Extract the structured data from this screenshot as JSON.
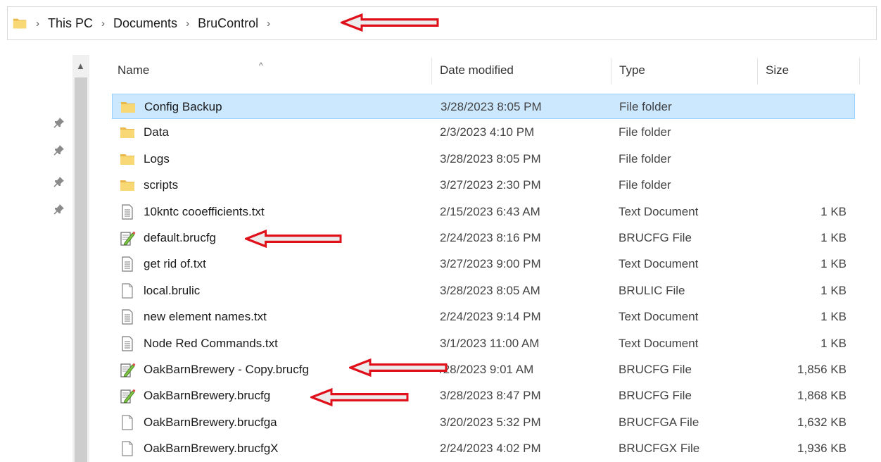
{
  "breadcrumb": [
    "This PC",
    "Documents",
    "BruControl"
  ],
  "columns": {
    "name": "Name",
    "date": "Date modified",
    "type": "Type",
    "size": "Size"
  },
  "files": [
    {
      "name": "Config Backup",
      "date": "3/28/2023 8:05 PM",
      "type": "File folder",
      "size": "",
      "icon": "folder-icon",
      "selected": true
    },
    {
      "name": "Data",
      "date": "2/3/2023 4:10 PM",
      "type": "File folder",
      "size": "",
      "icon": "folder-icon"
    },
    {
      "name": "Logs",
      "date": "3/28/2023 8:05 PM",
      "type": "File folder",
      "size": "",
      "icon": "folder-icon"
    },
    {
      "name": "scripts",
      "date": "3/27/2023 2:30 PM",
      "type": "File folder",
      "size": "",
      "icon": "folder-icon"
    },
    {
      "name": "10kntc cooefficients.txt",
      "date": "2/15/2023 6:43 AM",
      "type": "Text Document",
      "size": "1 KB",
      "icon": "text-document-icon"
    },
    {
      "name": "default.brucfg",
      "date": "2/24/2023 8:16 PM",
      "type": "BRUCFG File",
      "size": "1 KB",
      "icon": "edit-document-icon"
    },
    {
      "name": "get rid of.txt",
      "date": "3/27/2023 9:00 PM",
      "type": "Text Document",
      "size": "1 KB",
      "icon": "text-document-icon"
    },
    {
      "name": "local.brulic",
      "date": "3/28/2023 8:05 AM",
      "type": "BRULIC File",
      "size": "1 KB",
      "icon": "blank-document-icon"
    },
    {
      "name": "new element names.txt",
      "date": "2/24/2023 9:14 PM",
      "type": "Text Document",
      "size": "1 KB",
      "icon": "text-document-icon"
    },
    {
      "name": "Node Red Commands.txt",
      "date": "3/1/2023 11:00 AM",
      "type": "Text Document",
      "size": "1 KB",
      "icon": "text-document-icon"
    },
    {
      "name": "OakBarnBrewery - Copy.brucfg",
      "date": "/28/2023 9:01 AM",
      "type": "BRUCFG File",
      "size": "1,856 KB",
      "icon": "edit-document-icon"
    },
    {
      "name": "OakBarnBrewery.brucfg",
      "date": "3/28/2023 8:47 PM",
      "type": "BRUCFG File",
      "size": "1,868 KB",
      "icon": "edit-document-icon"
    },
    {
      "name": "OakBarnBrewery.brucfga",
      "date": "3/20/2023 5:32 PM",
      "type": "BRUCFGA File",
      "size": "1,632 KB",
      "icon": "blank-document-icon"
    },
    {
      "name": "OakBarnBrewery.brucfgX",
      "date": "2/24/2023 4:02 PM",
      "type": "BRUCFGX File",
      "size": "1,936 KB",
      "icon": "blank-document-icon"
    }
  ],
  "colors": {
    "selection": "#cce8ff",
    "selection_border": "#99d1ff",
    "arrow": "#e0101a",
    "folder": "#f8d775"
  }
}
